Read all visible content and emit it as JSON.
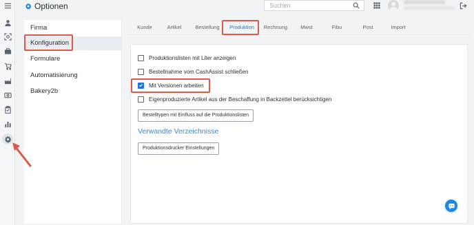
{
  "header": {
    "title": "Optionen",
    "search": {
      "placeholder": "Suchen",
      "value": ""
    }
  },
  "rail": {
    "items": [
      {
        "icon": "menu-icon"
      },
      {
        "icon": "person-icon"
      },
      {
        "icon": "scan-icon"
      },
      {
        "icon": "briefcase-icon"
      },
      {
        "icon": "cart-icon"
      },
      {
        "icon": "factory-icon"
      },
      {
        "icon": "cash-icon"
      },
      {
        "icon": "clipboard-icon"
      },
      {
        "icon": "bar-chart-icon"
      },
      {
        "icon": "gear-icon",
        "active": true
      }
    ]
  },
  "sidebar": {
    "items": [
      {
        "label": "Firma"
      },
      {
        "label": "Konfiguration",
        "active": true
      },
      {
        "label": "Formulare"
      },
      {
        "label": "Automatisierung"
      },
      {
        "label": "Bakery2b"
      }
    ]
  },
  "tabs": [
    {
      "label": "Kunde"
    },
    {
      "label": "Artikel"
    },
    {
      "label": "Bestellung"
    },
    {
      "label": "Produktion",
      "active": true
    },
    {
      "label": "Rechnung"
    },
    {
      "label": "Mwst"
    },
    {
      "label": "Fibu"
    },
    {
      "label": "Post"
    },
    {
      "label": "Import"
    }
  ],
  "options": [
    {
      "label": "Produktionslisten mit Liter anzeigen",
      "checked": false
    },
    {
      "label": "Bestellnahme vom CashAssist schließen",
      "checked": false
    },
    {
      "label": "Mit Versionen arbeiten",
      "checked": true
    },
    {
      "label": "Eigenproduzierte Artikel aus der Beschaffung in Backzettel berücksichtigen",
      "checked": false
    }
  ],
  "buttons": {
    "bestelltypen": "Bestelltypen mit Einfluss auf die Produktionslisten",
    "druckereinstellungen": "Produktionsdrucker Einstellungen"
  },
  "section": {
    "title": "Verwandte Verzeichnisse"
  },
  "colors": {
    "accent": "#1976d2",
    "highlight": "#e0584a",
    "section_title": "#3a86d4"
  }
}
